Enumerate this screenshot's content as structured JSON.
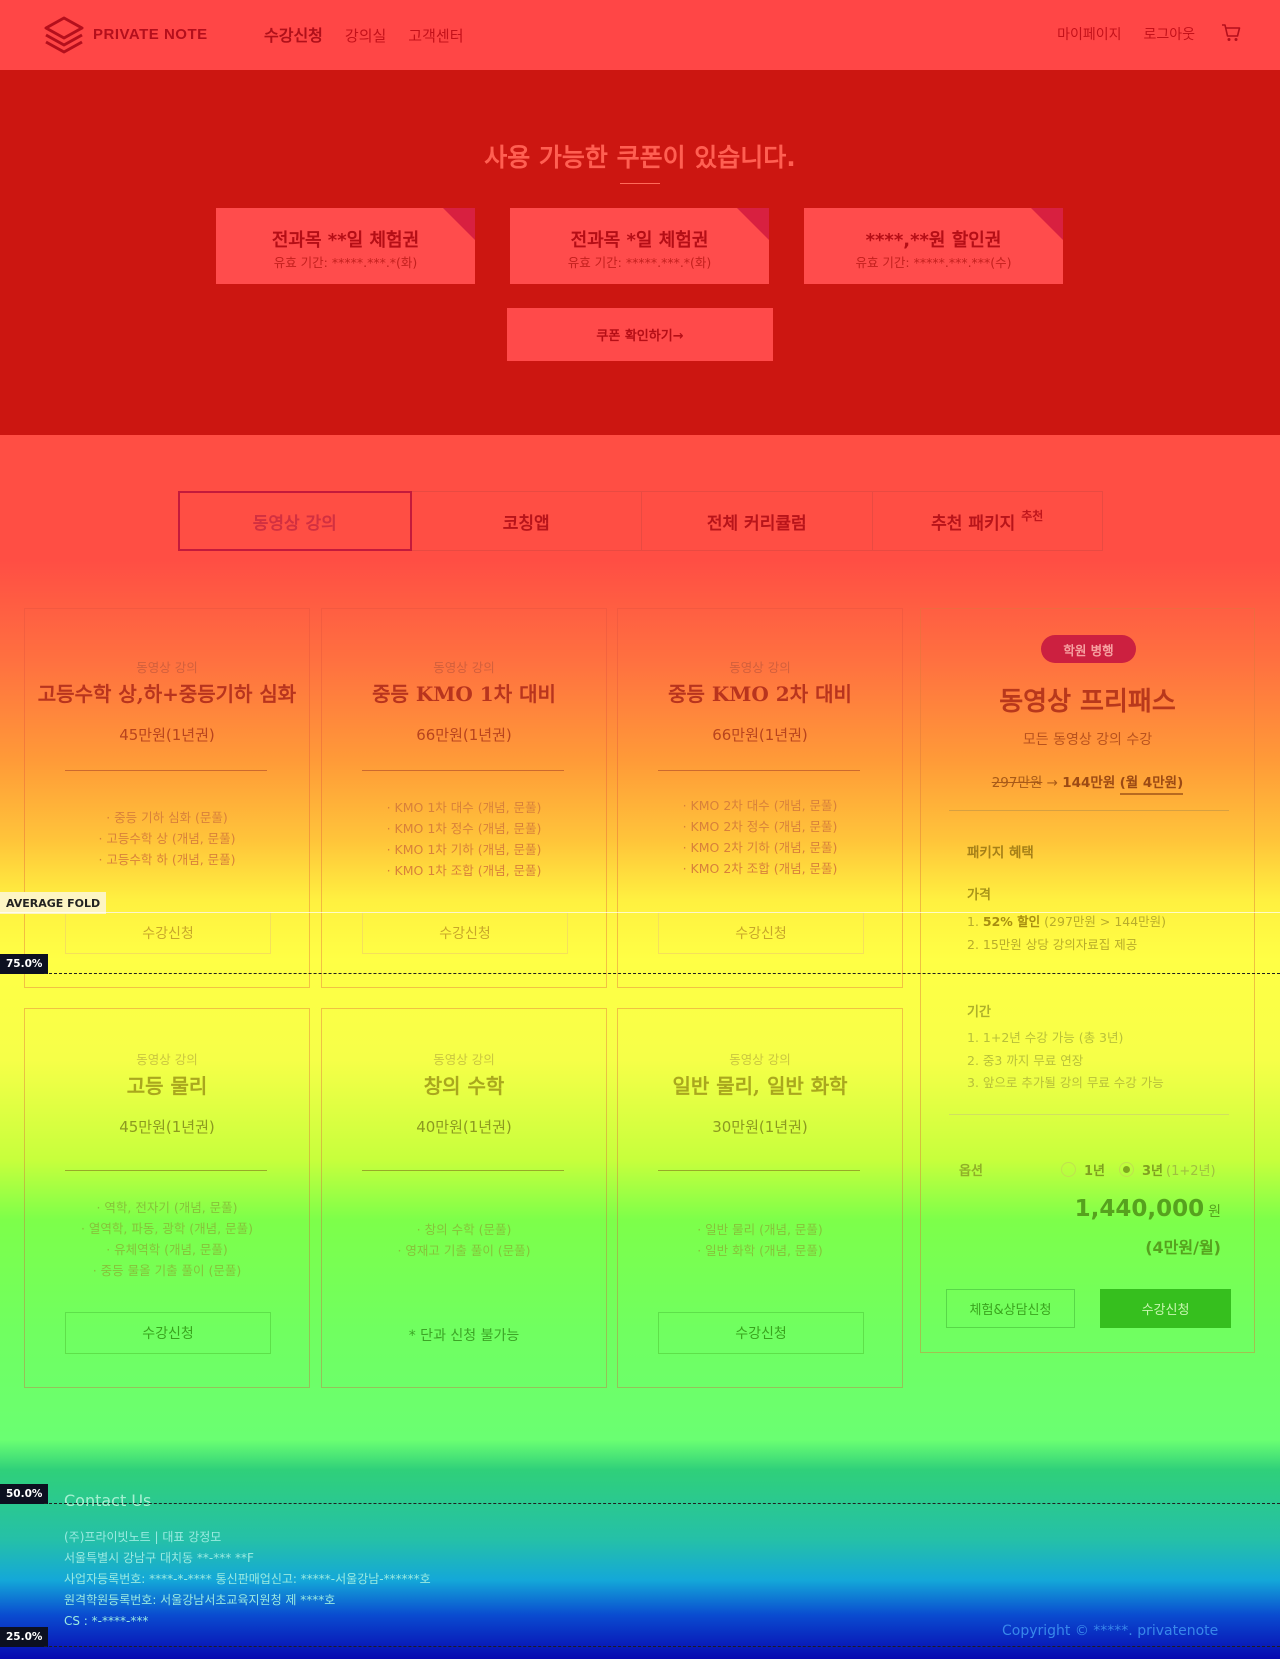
{
  "header": {
    "brand": "PRIVATE NOTE",
    "nav": [
      "수강신청",
      "강의실",
      "고객센터"
    ],
    "user_menu": [
      "마이페이지",
      "로그아웃"
    ]
  },
  "coupon_section": {
    "title": "사용 가능한 쿠폰이 있습니다.",
    "coupons": [
      {
        "name": "전과목 **일 체험권",
        "validity": "유효 기간: *****.***.*(화)"
      },
      {
        "name": "전과목 *일 체험권",
        "validity": "유효 기간: *****.***.*(화)"
      },
      {
        "name": "****,**원 할인권",
        "validity": "유효 기간: *****.***.***(수)"
      }
    ],
    "button": "쿠폰 확인하기→"
  },
  "tabs": {
    "items": [
      "동영상 강의",
      "코칭앱",
      "전체 커리큘럼",
      "추천 패키지"
    ],
    "recommend_tag": "추천"
  },
  "courses": [
    {
      "category": "동영상 강의",
      "name": "고등수학 상,하+중등기하 심화",
      "price": "45만원(1년권)",
      "items": [
        "· 중등 기하 심화 (문풀)",
        "· 고등수학 상 (개념, 문풀)",
        "· 고등수학 하 (개념, 문풀)"
      ],
      "button": "수강신청"
    },
    {
      "category": "동영상 강의",
      "name": "중등 KMO 1차 대비",
      "price": "66만원(1년권)",
      "items": [
        "· KMO 1차 대수 (개념, 문풀)",
        "· KMO 1차 정수 (개념, 문풀)",
        "· KMO 1차 기하 (개념, 문풀)",
        "· KMO 1차 조합 (개념, 문풀)"
      ],
      "button": "수강신청"
    },
    {
      "category": "동영상 강의",
      "name": "중등 KMO 2차 대비",
      "price": "66만원(1년권)",
      "items": [
        "· KMO 2차 대수 (개념, 문풀)",
        "· KMO 2차 정수 (개념, 문풀)",
        "· KMO 2차 기하 (개념, 문풀)",
        "· KMO 2차 조합 (개념, 문풀)"
      ],
      "button": "수강신청"
    },
    {
      "category": "동영상 강의",
      "name": "고등 물리",
      "price": "45만원(1년권)",
      "items": [
        "· 역학, 전자기 (개념, 문풀)",
        "· 열역학, 파동, 광학 (개념, 문풀)",
        "· 유체역학 (개념, 문풀)",
        "· 중등 물올 기출 풀이 (문풀)"
      ],
      "button": "수강신청"
    },
    {
      "category": "동영상 강의",
      "name": "창의 수학",
      "price": "40만원(1년권)",
      "items": [
        "· 창의 수학 (문풀)",
        "· 영재고 기출 풀이 (문풀)"
      ],
      "note": "* 단과 신청 불가능"
    },
    {
      "category": "동영상 강의",
      "name": "일반 물리, 일반 화학",
      "price": "30만원(1년권)",
      "items": [
        "· 일반 물리 (개념, 문풀)",
        "· 일반 화학 (개념, 문풀)"
      ],
      "button": "수강신청"
    }
  ],
  "package": {
    "badge": "학원 병행",
    "title": "동영상 프리패스",
    "subtitle": "모든 동영상 강의 수강",
    "old_price": "297만원",
    "arrow": "→",
    "new_price": "144만원",
    "monthly": "(월 4만원)",
    "benefits_title": "패키지 혜택",
    "price_title": "가격",
    "price_items": [
      {
        "prefix": "1. ",
        "highlight": "52% 할인",
        "rest": " (297만원 > 144만원)"
      },
      {
        "prefix": "2. ",
        "highlight": "",
        "rest": "15만원 상당 강의자료집 제공"
      }
    ],
    "period_title": "기간",
    "period_items": [
      "1. 1+2년 수강 가능 (총 3년)",
      "2. 중3 까지 무료 연장",
      "3. 앞으로 추가될 강의 무료 수강 가능"
    ],
    "option_label": "옵션",
    "options": [
      {
        "label": "1년",
        "hint": "",
        "selected": false
      },
      {
        "label": "3년",
        "hint": "(1+2년)",
        "selected": true
      }
    ],
    "total": "1,440,000",
    "currency": "원",
    "monthly_total": "(4만원/월)",
    "trial_button": "체험&상담신청",
    "enroll_button": "수강신청"
  },
  "footer": {
    "contact_title": "Contact Us",
    "lines": [
      "(주)프라이빗노트 | 대표 강정모",
      "서울특별시 강남구 대치동 **-*** **F",
      "사업자등록번호: ****-*-**** 통신판매업신고: *****-서울강남-******호",
      "원격학원등록번호: 서울강남서초교육지원청 제 ****호",
      "CS : *-****-***"
    ],
    "copyright": "Copyright © *****. privatenote"
  },
  "heatmap": {
    "fold_label": "AVERAGE FOLD",
    "markers": [
      "75.0%",
      "50.0%",
      "25.0%"
    ]
  },
  "colors": {
    "header": "#ff4646",
    "coupon_band": "#cc1611",
    "badge": "#cc2040",
    "enroll_button": "#36bf1e"
  }
}
